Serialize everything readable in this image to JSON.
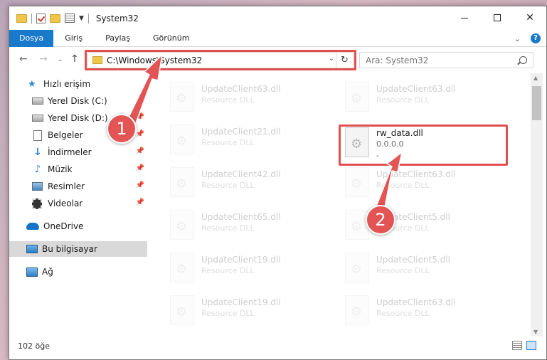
{
  "window": {
    "title": "System32",
    "controls": {
      "minimize": "minimize",
      "maximize": "maximize",
      "close": "✕"
    }
  },
  "ribbon": {
    "tabs": [
      {
        "label": "Dosya",
        "active": true
      },
      {
        "label": "Giriş"
      },
      {
        "label": "Paylaş"
      },
      {
        "label": "Görünüm"
      }
    ],
    "help": "?"
  },
  "address": {
    "path": "C:\\Windows\\System32"
  },
  "search": {
    "placeholder": "Ara: System32"
  },
  "sidebar": {
    "items": [
      {
        "label": "Hızlı erişim",
        "icon": "star-icon"
      },
      {
        "label": "Yerel Disk (C:)",
        "icon": "disk-icon",
        "pinned": true
      },
      {
        "label": "Yerel Disk (D:)",
        "icon": "disk-icon",
        "pinned": true
      },
      {
        "label": "Belgeler",
        "icon": "document-icon",
        "pinned": true
      },
      {
        "label": "İndirmeler",
        "icon": "download-icon",
        "pinned": true
      },
      {
        "label": "Müzik",
        "icon": "music-icon",
        "pinned": true
      },
      {
        "label": "Resimler",
        "icon": "pictures-icon",
        "pinned": true
      },
      {
        "label": "Videolar",
        "icon": "video-icon",
        "pinned": true
      },
      {
        "label": "OneDrive",
        "icon": "cloud-icon"
      },
      {
        "label": "Bu bilgisayar",
        "icon": "computer-icon",
        "selected": true
      },
      {
        "label": "Ağ",
        "icon": "network-icon"
      }
    ]
  },
  "files": {
    "left": [
      {
        "name": "UpdateClient63.dll",
        "sub": "Resource DLL"
      },
      {
        "name": "UpdateClient21.dll",
        "sub": "Resource DLL"
      },
      {
        "name": "UpdateClient42.dll",
        "sub": "Resource DLL"
      },
      {
        "name": "UpdateClient65.dll",
        "sub": "Resource DLL"
      },
      {
        "name": "UpdateClient19.dll",
        "sub": "Resource DLL"
      },
      {
        "name": "UpdateClient19.dll",
        "sub": "Resource DLL"
      }
    ],
    "right": [
      {
        "name": "UpdateClient63.dll",
        "sub": "Resource DLL"
      },
      {
        "name": "rw_data.dll",
        "sub": "0.0.0.0",
        "sub2": "-",
        "highlight": true
      },
      {
        "name": "UpdateClient63.dll",
        "sub": "Resource DLL"
      },
      {
        "name": "UpdateClient5.dll",
        "sub": "Resource DLL"
      },
      {
        "name": "UpdateClient5.dll",
        "sub": "Resource DLL"
      },
      {
        "name": "UpdateClient63.dll",
        "sub": "Resource DLL"
      }
    ]
  },
  "status": {
    "count": "102 öğe"
  },
  "annotations": {
    "badge1": "1",
    "badge2": "2",
    "color": "#e35454"
  }
}
